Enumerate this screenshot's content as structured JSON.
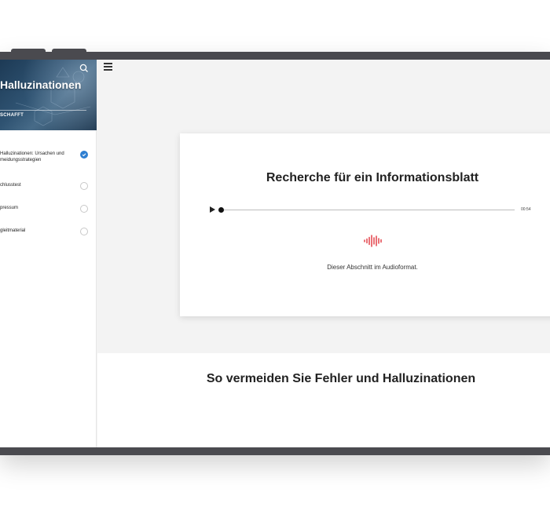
{
  "hero": {
    "title": "Halluzinationen",
    "subtitle": "SCHAFFT"
  },
  "sidebar": {
    "items": [
      {
        "label": "Halluzinationen: Ursachen und Vermeidungsstrategien",
        "display": "Halluzinationen: Ursachen und\nmeidungsstrategien",
        "completed": true
      },
      {
        "label": "chlusstest",
        "completed": false
      },
      {
        "label": "pressum",
        "completed": false
      },
      {
        "label": "gleitmaterial",
        "completed": false
      }
    ]
  },
  "audio_card": {
    "title": "Recherche für ein Informationsblatt",
    "time": "00:54",
    "progress": 0.0,
    "caption": "Dieser Abschnitt im Audioformat.",
    "icon": "audio-wave-icon",
    "accent_color": "#e2343c"
  },
  "section": {
    "title": "So vermeiden Sie Fehler und Halluzinationen"
  },
  "colors": {
    "device_frame": "#4a4a4f",
    "check_blue": "#2f7fd1"
  }
}
